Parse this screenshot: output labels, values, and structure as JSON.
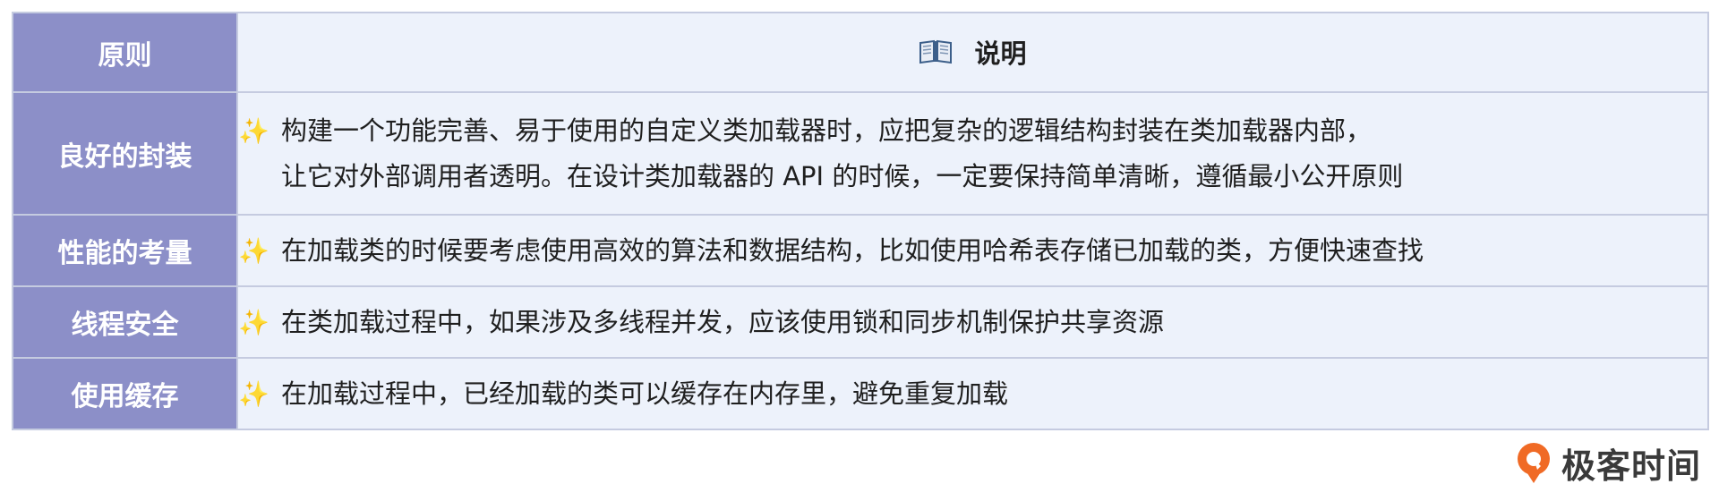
{
  "table": {
    "header": {
      "col1": "原则",
      "col2_icon": "open-book-icon",
      "col2": "说明"
    },
    "bullet_icon": "sparkles-icon",
    "rows": [
      {
        "principle": "良好的封装",
        "lines": [
          "构建一个功能完善、易于使用的自定义类加载器时，应把复杂的逻辑结构封装在类加载器内部，",
          "让它对外部调用者透明。在设计类加载器的 API 的时候，一定要保持简单清晰，遵循最小公开原则"
        ]
      },
      {
        "principle": "性能的考量",
        "lines": [
          "在加载类的时候要考虑使用高效的算法和数据结构，比如使用哈希表存储已加载的类，方便快速查找"
        ]
      },
      {
        "principle": "线程安全",
        "lines": [
          "在类加载过程中，如果涉及多线程并发，应该使用锁和同步机制保护共享资源"
        ]
      },
      {
        "principle": "使用缓存",
        "lines": [
          "在加载过程中，已经加载的类可以缓存在内存里，避免重复加载"
        ]
      }
    ]
  },
  "logo": {
    "text": "极客时间",
    "accent_color": "#f06a25"
  },
  "colors": {
    "header_left_bg": "#8c8fc8",
    "cell_right_bg": "#edf2fb",
    "border": "#c5cbe0",
    "sparkle": "#f2b824"
  }
}
